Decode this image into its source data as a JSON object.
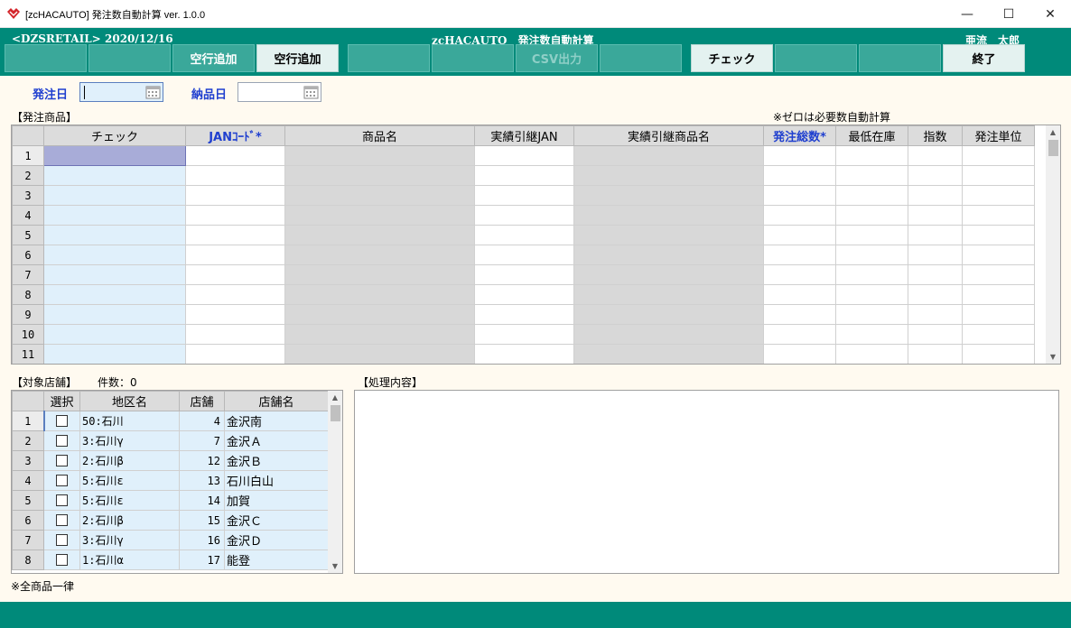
{
  "window": {
    "title": "[zcHACAUTO] 発注数自動計算 ver. 1.0.0",
    "min": "—",
    "max": "☐",
    "close": "✕"
  },
  "header": {
    "company": "<DZSRETAIL>",
    "date": "2020/12/16",
    "program": "zcHACAUTO　発注数自動計算",
    "user": "亜流　太郎"
  },
  "fkeys": [
    "",
    "",
    "空行追加",
    "",
    "",
    "CSV出力",
    "",
    "",
    "チェック",
    "",
    "",
    "終了"
  ],
  "form": {
    "order_date_label": "発注日",
    "order_date_value": "",
    "delivery_date_label": "納品日",
    "delivery_date_value": ""
  },
  "products": {
    "section_label": "【発注商品】",
    "note": "※ゼロは必要数自動計算",
    "columns": [
      "チェック",
      "JANｺｰﾄﾞ*",
      "商品名",
      "実績引継JAN",
      "実績引継商品名",
      "発注総数*",
      "最低在庫",
      "指数",
      "発注単位"
    ],
    "rows": [
      "1",
      "2",
      "3",
      "4",
      "5",
      "6",
      "7",
      "8",
      "9",
      "10",
      "11"
    ]
  },
  "stores": {
    "section_label": "【対象店舗】",
    "count_label": "件数：0",
    "columns": [
      "選択",
      "地区名",
      "店舗",
      "店舗名"
    ],
    "rows": [
      {
        "no": "1",
        "area": "50:石川",
        "store": "4",
        "name": "金沢南"
      },
      {
        "no": "2",
        "area": "3:石川γ",
        "store": "7",
        "name": "金沢Ａ"
      },
      {
        "no": "3",
        "area": "2:石川β",
        "store": "12",
        "name": "金沢Ｂ"
      },
      {
        "no": "4",
        "area": "5:石川ε",
        "store": "13",
        "name": "石川白山"
      },
      {
        "no": "5",
        "area": "5:石川ε",
        "store": "14",
        "name": "加賀"
      },
      {
        "no": "6",
        "area": "2:石川β",
        "store": "15",
        "name": "金沢Ｃ"
      },
      {
        "no": "7",
        "area": "3:石川γ",
        "store": "16",
        "name": "金沢Ｄ"
      },
      {
        "no": "8",
        "area": "1:石川α",
        "store": "17",
        "name": "能登"
      }
    ],
    "footer_note": "※全商品一律"
  },
  "process": {
    "section_label": "【処理内容】",
    "content": ""
  },
  "colors": {
    "teal": "#008a7a",
    "label_blue": "#1f3fcf",
    "cell_light_blue": "#e0f0fb",
    "cell_gray": "#d8d8d8",
    "selected_cell": "#a8acd8"
  }
}
